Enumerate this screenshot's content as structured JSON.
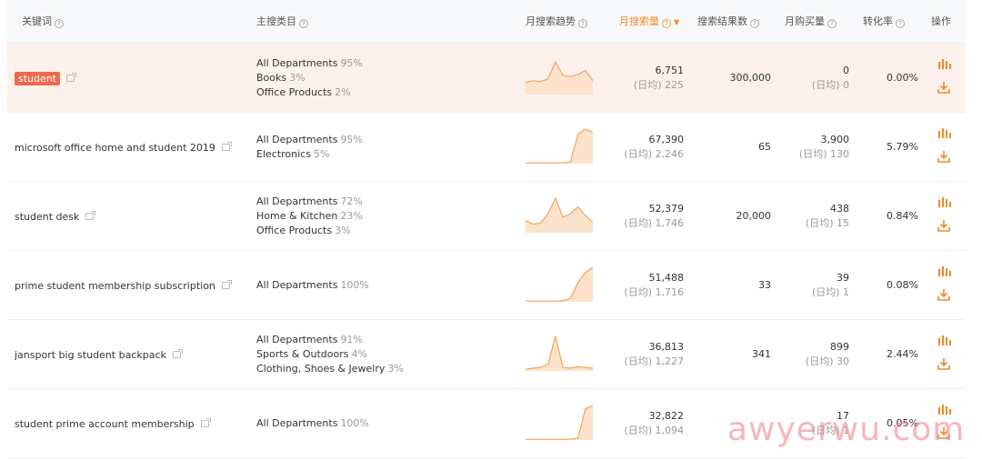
{
  "header": {
    "keyword": "关键词",
    "category": "主搜类目",
    "trend": "月搜索趋势",
    "volume": "月搜索量",
    "results": "搜索结果数",
    "purchases": "月购买量",
    "conversion": "转化率",
    "actions": "操作"
  },
  "colors": {
    "accent": "#f08a24",
    "highlight_row": "#fdf1ee",
    "tag": "#ee6a4a",
    "trend_line": "#f5a35a",
    "trend_fill": "#fde3cc"
  },
  "icons": {
    "help": "question-circle-icon",
    "external": "external-link-icon",
    "chart": "bar-chart-icon",
    "download": "download-icon",
    "sort": "sort-down-icon"
  },
  "rows": [
    {
      "keyword": "student",
      "categories": [
        {
          "name": "All Departments",
          "pct": "95%"
        },
        {
          "name": "Books",
          "pct": "3%"
        },
        {
          "name": "Office Products",
          "pct": "2%"
        }
      ],
      "trend": [
        0.35,
        0.4,
        0.38,
        0.45,
        0.95,
        0.55,
        0.52,
        0.58,
        0.7,
        0.4
      ],
      "volume": "6,751",
      "volume_daily": "(日均) 225",
      "results": "300,000",
      "purchases": "0",
      "purchases_daily": "(日均) 0",
      "conversion": "0.00%"
    },
    {
      "keyword": "microsoft office home and student 2019",
      "categories": [
        {
          "name": "All Departments",
          "pct": "95%"
        },
        {
          "name": "Electronics",
          "pct": "5%"
        }
      ],
      "trend": [
        0.02,
        0.02,
        0.02,
        0.02,
        0.02,
        0.02,
        0.05,
        0.85,
        1.0,
        0.9
      ],
      "volume": "67,390",
      "volume_daily": "(日均) 2,246",
      "results": "65",
      "purchases": "3,900",
      "purchases_daily": "(日均) 130",
      "conversion": "5.79%"
    },
    {
      "keyword": "student desk",
      "categories": [
        {
          "name": "All Departments",
          "pct": "72%"
        },
        {
          "name": "Home & Kitchen",
          "pct": "23%"
        },
        {
          "name": "Office Products",
          "pct": "3%"
        }
      ],
      "trend": [
        0.35,
        0.25,
        0.28,
        0.55,
        1.0,
        0.45,
        0.55,
        0.75,
        0.5,
        0.3
      ],
      "volume": "52,379",
      "volume_daily": "(日均) 1,746",
      "results": "20,000",
      "purchases": "438",
      "purchases_daily": "(日均) 15",
      "conversion": "0.84%"
    },
    {
      "keyword": "prime student membership subscription",
      "categories": [
        {
          "name": "All Departments",
          "pct": "100%"
        }
      ],
      "trend": [
        0.02,
        0.02,
        0.02,
        0.02,
        0.02,
        0.03,
        0.1,
        0.55,
        0.85,
        1.0
      ],
      "volume": "51,488",
      "volume_daily": "(日均) 1,716",
      "results": "33",
      "purchases": "39",
      "purchases_daily": "(日均) 1",
      "conversion": "0.08%"
    },
    {
      "keyword": "jansport big student backpack",
      "categories": [
        {
          "name": "All Departments",
          "pct": "91%"
        },
        {
          "name": "Sports & Outdoors",
          "pct": "4%"
        },
        {
          "name": "Clothing, Shoes & Jewelry",
          "pct": "3%"
        }
      ],
      "trend": [
        0.05,
        0.08,
        0.1,
        0.2,
        1.0,
        0.1,
        0.08,
        0.12,
        0.1,
        0.08
      ],
      "volume": "36,813",
      "volume_daily": "(日均) 1,227",
      "results": "341",
      "purchases": "899",
      "purchases_daily": "(日均) 30",
      "conversion": "2.44%"
    },
    {
      "keyword": "student prime account membership",
      "categories": [
        {
          "name": "All Departments",
          "pct": "100%"
        }
      ],
      "trend": [
        0.02,
        0.02,
        0.02,
        0.02,
        0.02,
        0.02,
        0.02,
        0.05,
        0.9,
        1.0
      ],
      "volume": "32,822",
      "volume_daily": "(日均) 1,094",
      "results": "",
      "purchases": "17",
      "purchases_daily": "(日均) 1",
      "conversion": "0.05%"
    }
  ],
  "watermark": "awyerwu.com"
}
